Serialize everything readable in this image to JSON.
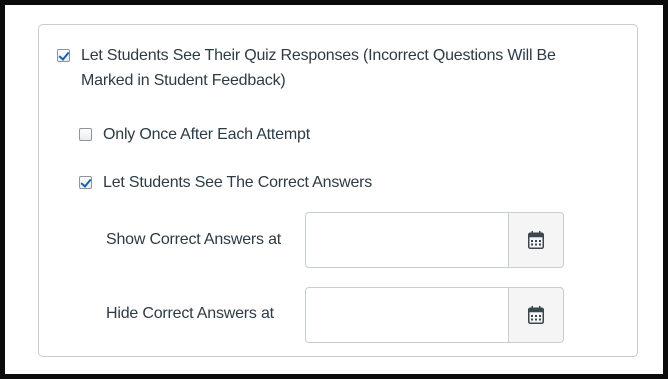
{
  "quiz_settings": {
    "see_responses": {
      "label_line1": "Let Students See Their Quiz Responses (Incorrect Questions Will Be",
      "label_line2": "Marked in Student Feedback)",
      "checked": true
    },
    "only_once": {
      "label": "Only Once After Each Attempt",
      "checked": false
    },
    "see_correct": {
      "label": "Let Students See The Correct Answers",
      "checked": true
    },
    "show_correct_at": {
      "label": "Show Correct Answers at",
      "value": "",
      "icon": "calendar-icon"
    },
    "hide_correct_at": {
      "label": "Hide Correct Answers at",
      "value": "",
      "icon": "calendar-icon"
    }
  }
}
